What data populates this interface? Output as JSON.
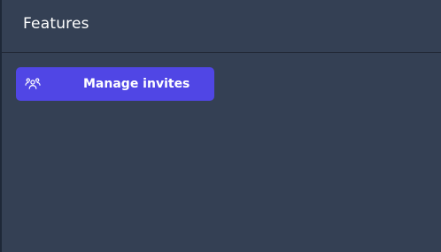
{
  "panel": {
    "title": "Features"
  },
  "actions": [
    {
      "label": "Manage invites",
      "icon": "users-icon"
    }
  ],
  "colors": {
    "panel_bg": "#344054",
    "button_bg": "#5046e5",
    "text": "#ffffff"
  }
}
